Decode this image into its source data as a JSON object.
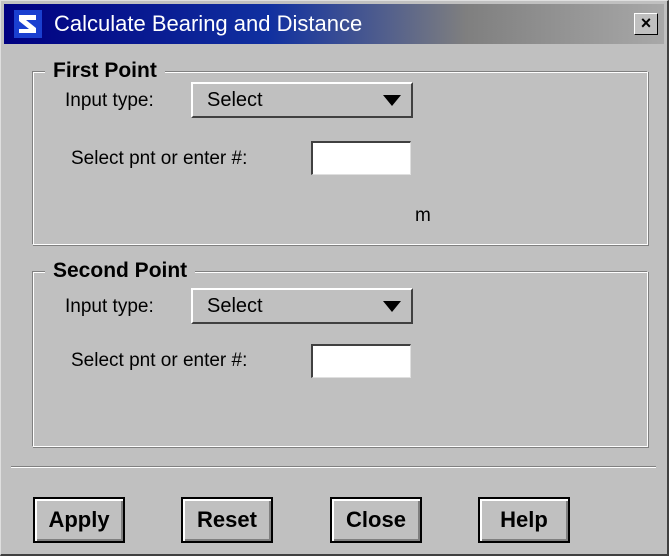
{
  "window": {
    "title": "Calculate Bearing and Distance",
    "close_glyph": "×",
    "icon": "app-logo-icon"
  },
  "first_point": {
    "legend": "First Point",
    "input_type_label": "Input type:",
    "input_type_value": "Select",
    "select_label": "Select pnt or enter #:",
    "point_value": "",
    "unit": "m"
  },
  "second_point": {
    "legend": "Second Point",
    "input_type_label": "Input type:",
    "input_type_value": "Select",
    "select_label": "Select pnt or enter #:",
    "point_value": ""
  },
  "buttons": {
    "apply": "Apply",
    "reset": "Reset",
    "close": "Close",
    "help": "Help"
  },
  "colors": {
    "titlebar_start": "#000080",
    "titlebar_end": "#a8a8a8",
    "face": "#c0c0c0"
  }
}
